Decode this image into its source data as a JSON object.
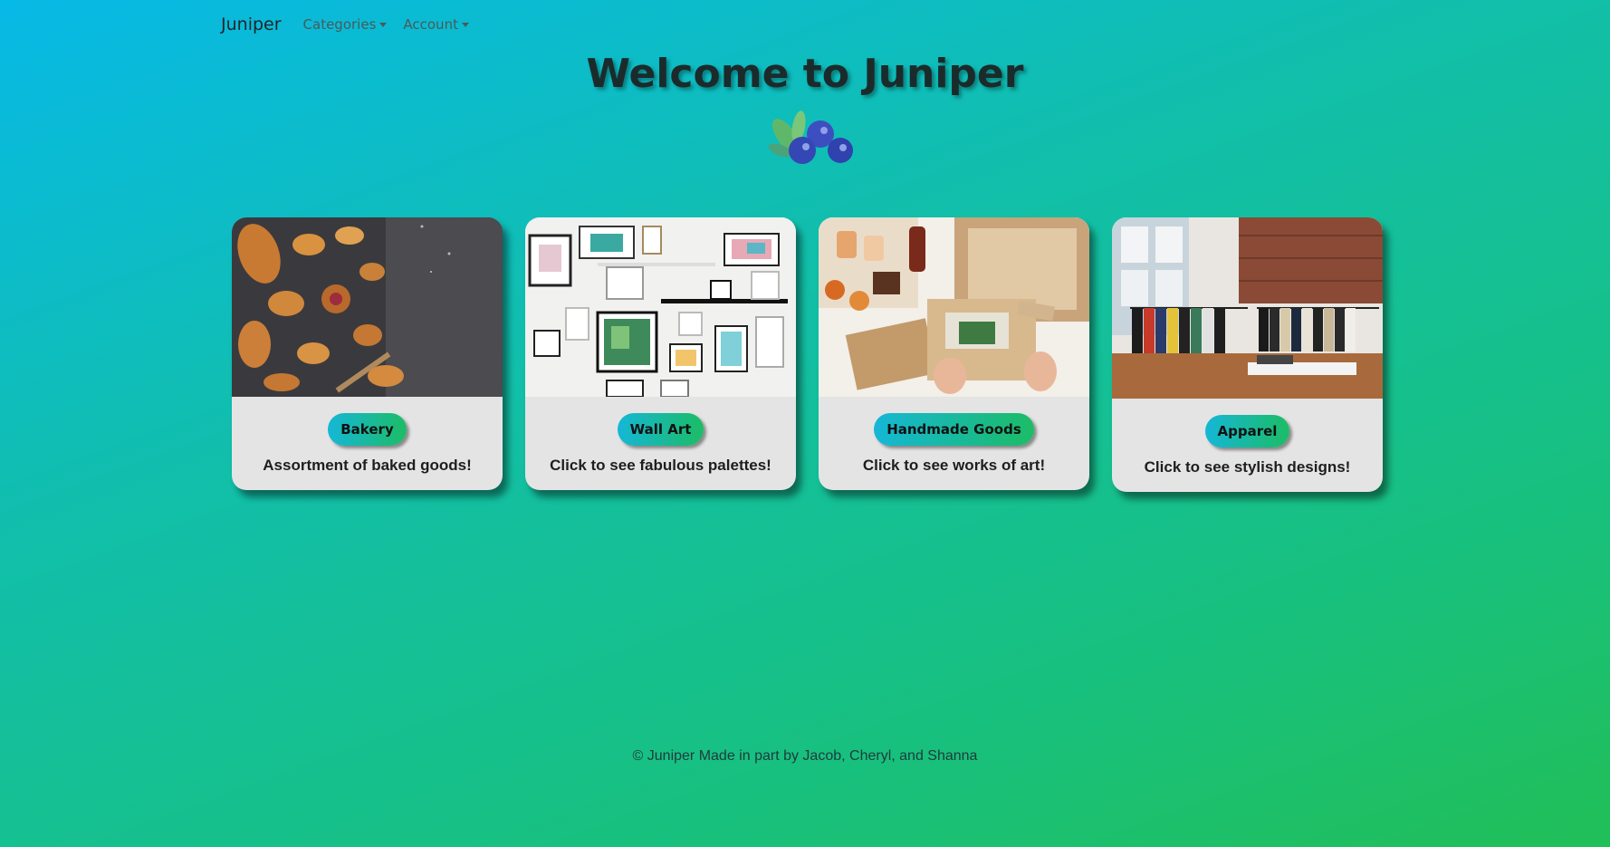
{
  "navbar": {
    "brand": "Juniper",
    "items": [
      {
        "label": "Categories"
      },
      {
        "label": "Account"
      }
    ]
  },
  "hero": {
    "title": "Welcome to Juniper"
  },
  "cards": [
    {
      "button": "Bakery",
      "description": "Assortment of baked goods!"
    },
    {
      "button": "Wall Art",
      "description": "Click to see fabulous palettes!"
    },
    {
      "button": "Handmade Goods",
      "description": "Click to see works of art!"
    },
    {
      "button": "Apparel",
      "description": "Click to see stylish designs!"
    }
  ],
  "footer": {
    "text": "© Juniper  Made in part by Jacob, Cheryl, and Shanna"
  },
  "colors": {
    "background_start": "#07b9e6",
    "background_end": "#21bf58",
    "card_bg": "#e4e4e4",
    "button_start": "#15b7d6",
    "button_end": "#1cbc66"
  }
}
